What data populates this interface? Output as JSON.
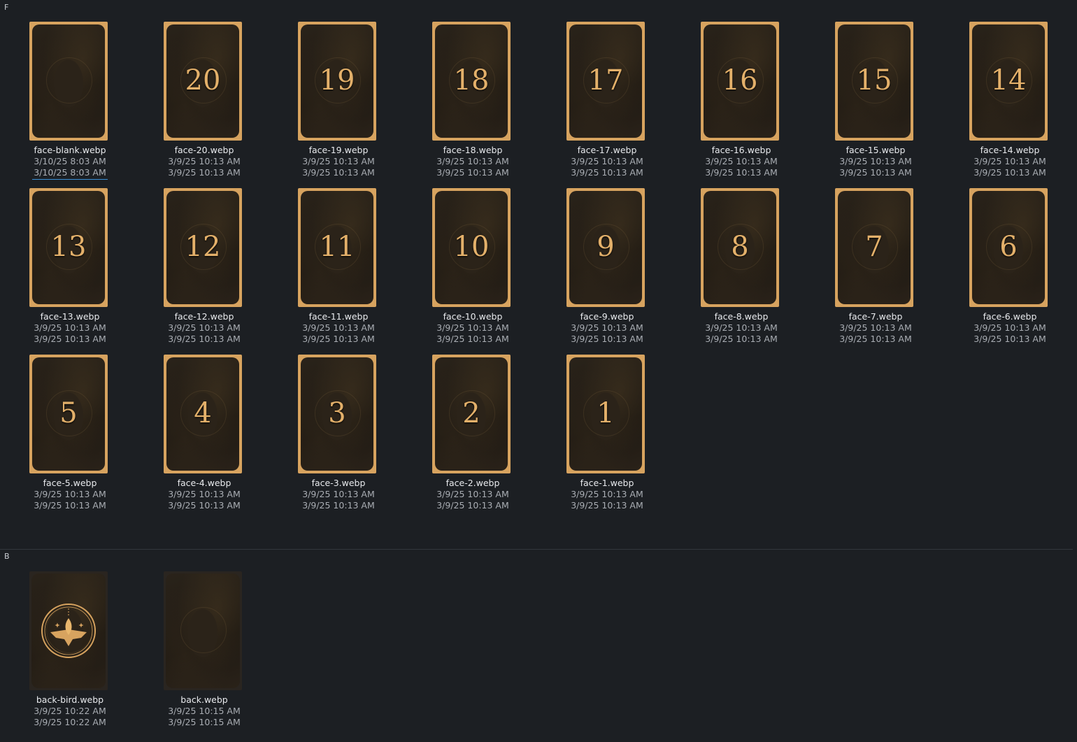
{
  "groups": {
    "f": {
      "label": "F",
      "files": [
        {
          "name": "face-blank.webp",
          "created": "3/10/25 8:03 AM",
          "modified": "3/10/25 8:03 AM",
          "number": ""
        },
        {
          "name": "face-20.webp",
          "created": "3/9/25 10:13 AM",
          "modified": "3/9/25 10:13 AM",
          "number": "20"
        },
        {
          "name": "face-19.webp",
          "created": "3/9/25 10:13 AM",
          "modified": "3/9/25 10:13 AM",
          "number": "19"
        },
        {
          "name": "face-18.webp",
          "created": "3/9/25 10:13 AM",
          "modified": "3/9/25 10:13 AM",
          "number": "18"
        },
        {
          "name": "face-17.webp",
          "created": "3/9/25 10:13 AM",
          "modified": "3/9/25 10:13 AM",
          "number": "17"
        },
        {
          "name": "face-16.webp",
          "created": "3/9/25 10:13 AM",
          "modified": "3/9/25 10:13 AM",
          "number": "16"
        },
        {
          "name": "face-15.webp",
          "created": "3/9/25 10:13 AM",
          "modified": "3/9/25 10:13 AM",
          "number": "15"
        },
        {
          "name": "face-14.webp",
          "created": "3/9/25 10:13 AM",
          "modified": "3/9/25 10:13 AM",
          "number": "14"
        },
        {
          "name": "face-13.webp",
          "created": "3/9/25 10:13 AM",
          "modified": "3/9/25 10:13 AM",
          "number": "13"
        },
        {
          "name": "face-12.webp",
          "created": "3/9/25 10:13 AM",
          "modified": "3/9/25 10:13 AM",
          "number": "12"
        },
        {
          "name": "face-11.webp",
          "created": "3/9/25 10:13 AM",
          "modified": "3/9/25 10:13 AM",
          "number": "11"
        },
        {
          "name": "face-10.webp",
          "created": "3/9/25 10:13 AM",
          "modified": "3/9/25 10:13 AM",
          "number": "10"
        },
        {
          "name": "face-9.webp",
          "created": "3/9/25 10:13 AM",
          "modified": "3/9/25 10:13 AM",
          "number": "9"
        },
        {
          "name": "face-8.webp",
          "created": "3/9/25 10:13 AM",
          "modified": "3/9/25 10:13 AM",
          "number": "8"
        },
        {
          "name": "face-7.webp",
          "created": "3/9/25 10:13 AM",
          "modified": "3/9/25 10:13 AM",
          "number": "7"
        },
        {
          "name": "face-6.webp",
          "created": "3/9/25 10:13 AM",
          "modified": "3/9/25 10:13 AM",
          "number": "6"
        },
        {
          "name": "face-5.webp",
          "created": "3/9/25 10:13 AM",
          "modified": "3/9/25 10:13 AM",
          "number": "5"
        },
        {
          "name": "face-4.webp",
          "created": "3/9/25 10:13 AM",
          "modified": "3/9/25 10:13 AM",
          "number": "4"
        },
        {
          "name": "face-3.webp",
          "created": "3/9/25 10:13 AM",
          "modified": "3/9/25 10:13 AM",
          "number": "3"
        },
        {
          "name": "face-2.webp",
          "created": "3/9/25 10:13 AM",
          "modified": "3/9/25 10:13 AM",
          "number": "2"
        },
        {
          "name": "face-1.webp",
          "created": "3/9/25 10:13 AM",
          "modified": "3/9/25 10:13 AM",
          "number": "1"
        }
      ]
    },
    "b": {
      "label": "B",
      "files": [
        {
          "name": "back-bird.webp",
          "created": "3/9/25 10:22 AM",
          "modified": "3/9/25 10:22 AM",
          "emblem": "bird-emblem-icon"
        },
        {
          "name": "back.webp",
          "created": "3/9/25 10:15 AM",
          "modified": "3/9/25 10:15 AM",
          "emblem": ""
        }
      ]
    }
  },
  "selected_file": "face-blank.webp",
  "colors": {
    "background": "#1c1f23",
    "card_gold": "#d7a35f",
    "number_gold": "#e3b06a",
    "filename_text": "#e8eaed",
    "date_text": "#a9adb3",
    "selection": "#3a8fd6"
  }
}
